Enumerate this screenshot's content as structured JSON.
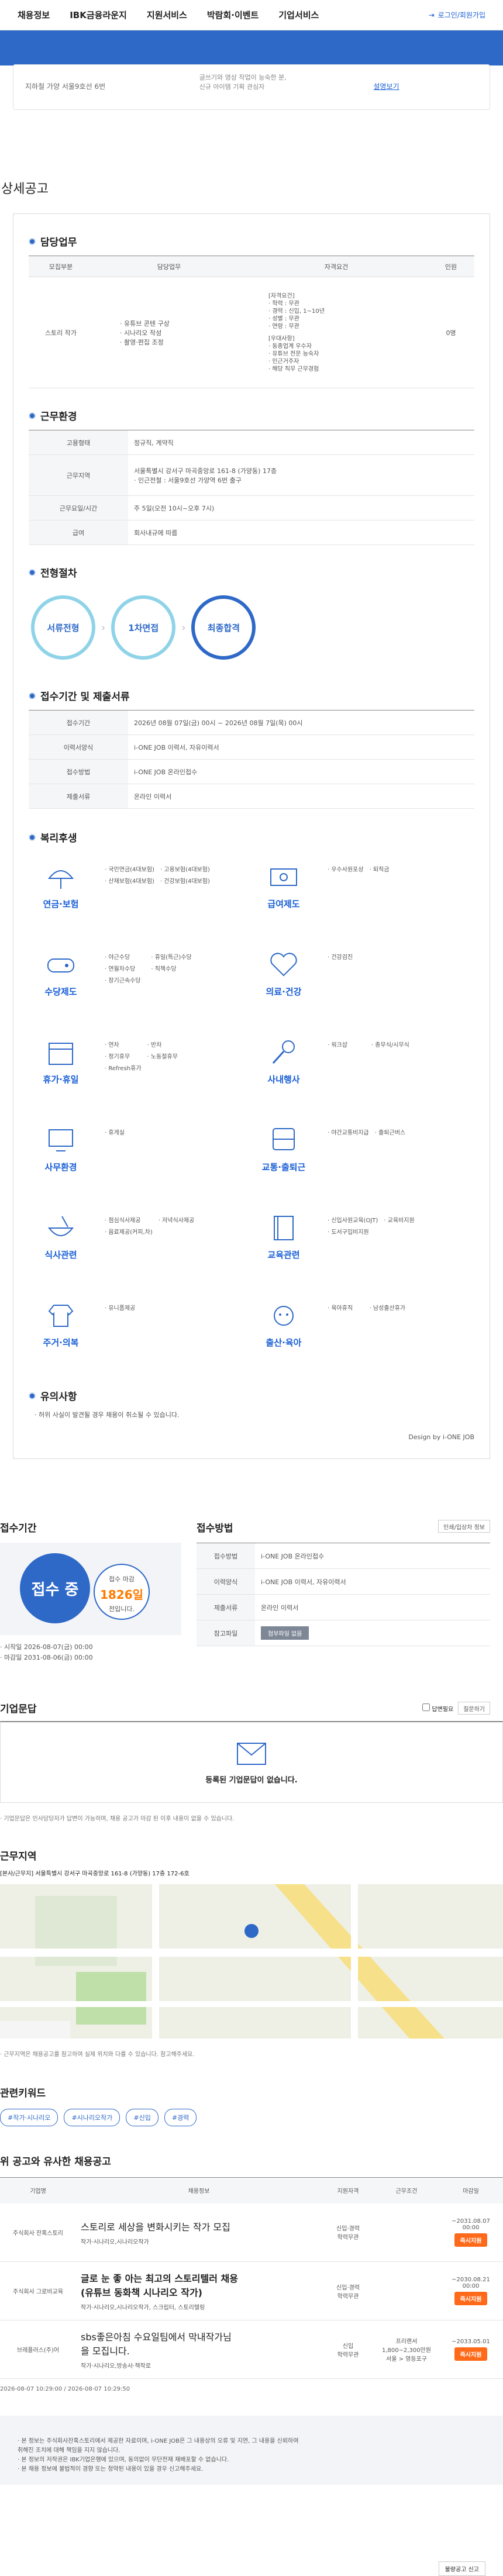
{
  "nav": {
    "items": [
      "채용정보",
      "IBK금융라운지",
      "지원서비스",
      "박람회·이벤트",
      "기업서비스"
    ],
    "login": "로그인/회원가입"
  },
  "hero": {
    "left": "지하철 가양 서울9호선 6번",
    "middle1": "글쓰기와 영상 작업이 능숙한 분,",
    "middle2": "신규 아이템 기획 관심자",
    "right": "설명보기"
  },
  "section_title": "상세공고",
  "duty": {
    "title": "담당업무",
    "headers": [
      "모집부분",
      "담당업무",
      "자격요건",
      "인원"
    ],
    "part": "스토리 작가",
    "tasks": [
      "· 유튜브 콘텐 구상",
      "· 시나리오 작성",
      "· 촬영·편집 조정"
    ],
    "req": [
      "[자격요건]",
      "· 학력 : 무관",
      "· 경력 : 신입, 1~10년",
      "· 성별 : 무관",
      "· 연령 : 무관",
      "",
      "[우대사항]",
      "· 동종업계 우수자",
      "· 유튜브 전문 능숙자",
      "· 인근거주자",
      "· 해당 직무 근무경험"
    ],
    "count": "0명"
  },
  "env": {
    "title": "근무환경",
    "rows": [
      [
        "고용형태",
        "정규직, 계약직"
      ],
      [
        "근무지역",
        "서울특별시 강서구 마곡중앙로 161-8 (가양동) 17층\n· 인근전철 : 서울9호선 가양역 6번 출구"
      ],
      [
        "근무요일/시간",
        "주 5일(오전 10시~오후 7시)"
      ],
      [
        "급여",
        "회사내규에 따름"
      ]
    ]
  },
  "process": {
    "title": "전형절차",
    "steps": [
      "서류전형",
      "1차면접",
      "최종합격"
    ]
  },
  "receipt": {
    "title": "접수기간 및 제출서류",
    "rows": [
      [
        "접수기간",
        "2026년 08월 07일(금) 00시 ~ 2026년 08월 7일(목) 00시"
      ],
      [
        "이력서양식",
        "i-ONE JOB 이력서, 자유이력서"
      ],
      [
        "접수방법",
        "i-ONE JOB 온라인접수"
      ],
      [
        "제출서류",
        "온라인 이력서"
      ]
    ]
  },
  "benefits": {
    "title": "복리후생",
    "items": [
      {
        "name": "연금·보험",
        "icon": "umbrella-icon",
        "list": [
          "· 국민연금(4대보험)",
          "· 고용보험(4대보험)",
          "· 산재보험(4대보험)",
          "· 건강보험(4대보험)"
        ]
      },
      {
        "name": "급여제도",
        "icon": "money-icon",
        "list": [
          "· 우수사원포상",
          "· 퇴직금"
        ]
      },
      {
        "name": "수당제도",
        "icon": "gamepad-icon",
        "list": [
          "· 야근수당",
          "· 휴일(특근)수당",
          "· 연월차수당",
          "· 직책수당",
          "· 장기근속수당"
        ]
      },
      {
        "name": "의료·건강",
        "icon": "heart-icon",
        "list": [
          "· 건강검진"
        ]
      },
      {
        "name": "휴가·휴일",
        "icon": "calendar-icon",
        "list": [
          "· 연차",
          "· 반차",
          "· 정기휴무",
          "· 노동절휴무",
          "· Refresh휴가"
        ]
      },
      {
        "name": "사내행사",
        "icon": "microphone-icon",
        "list": [
          "· 워크샵",
          "· 종무식/시무식"
        ]
      },
      {
        "name": "사무환경",
        "icon": "monitor-icon",
        "list": [
          "· 휴게실"
        ]
      },
      {
        "name": "교통·출퇴근",
        "icon": "bus-icon",
        "list": [
          "· 야간교통비지급",
          "· 출퇴근버스"
        ]
      },
      {
        "name": "식사관련",
        "icon": "bowl-icon",
        "list": [
          "· 점심식사제공",
          "· 저녁식사제공",
          "· 음료제공(커피,차)"
        ]
      },
      {
        "name": "교육관련",
        "icon": "book-icon",
        "list": [
          "· 신입사원교육(OJT)",
          "· 교육비지원",
          "· 도서구입비지원"
        ]
      },
      {
        "name": "주거·의복",
        "icon": "shirt-icon",
        "list": [
          "· 유니폼제공"
        ]
      },
      {
        "name": "출산·육아",
        "icon": "baby-icon",
        "list": [
          "· 육아휴직",
          "· 남성출산휴가"
        ]
      }
    ]
  },
  "caution": {
    "title": "유의사항",
    "text": "· 허위 사실이 발견될 경우 채용이 취소될 수 있습니다."
  },
  "design_by": "Design by i-ONE JOB",
  "apply": {
    "period_title": "접수기간",
    "status": "접수 중",
    "remain_label": "접수 마감",
    "remain_days": "1826일",
    "remain_suffix": "전입니다.",
    "start": "· 시작일 2026-08-07(금) 00:00",
    "end": "· 마감일 2031-08-06(금) 00:00",
    "method_title": "접수방법",
    "print_btn": "인쇄/입상차 정보",
    "rows": [
      [
        "접수방법",
        "i-ONE JOB 온라인접수"
      ],
      [
        "이력양식",
        "i-ONE JOB 이력서, 자유이력서"
      ],
      [
        "제출서류",
        "온라인 이력서"
      ],
      [
        "참고파일",
        "첨부파일 없음"
      ]
    ]
  },
  "qna": {
    "title": "기업문답",
    "check": "답변필요",
    "sort": "질문하기",
    "empty": "등록된 기업문답이 없습니다.",
    "note": "· 기업문답은 인사담당자가 답변이 가능하며, 채용 공고가 마감 된 이후 내용이 없을 수 있습니다."
  },
  "location": {
    "title": "근무지역",
    "addr": "[본사/근무지] 서울특별시 강서구 마곡중앙로 161-8 (가양동) 17층 172-6호",
    "note": "· 근무지역은 채용공고를 참고하여 실제 위치와 다를 수 있습니다. 참고해주세요."
  },
  "keywords": {
    "title": "관련키워드",
    "items": [
      "#작가·시나리오",
      "#시나리오작가",
      "#신입",
      "#경력"
    ]
  },
  "similar": {
    "title": "위 공고와 유사한 채용공고",
    "headers": [
      "기업명",
      "채용정보",
      "지원자격",
      "근무조건",
      "마감일"
    ],
    "rows": [
      {
        "company": "주식회사 잔혹스토리",
        "title": "스토리로 세상을 변화시키는 작가 모집",
        "sub": "작가·시나리오,시나리오작가",
        "qual": "신입·경력\n학력무관",
        "cond": "",
        "deadline": "~2031.08.07 00:00",
        "btn": "즉시지원"
      },
      {
        "company": "주식회사 그로비교육",
        "title": "글로 눈 좋 아는 최고의 스토리텔러 채용\n(유튜브 동화책 시나리오 작가)",
        "sub": "작가·시나리오,시나리오작가, 스크립터, 스토리텔링",
        "qual": "신입·경력\n학력무관",
        "cond": "",
        "deadline": "~2030.08.21 00:00",
        "btn": "즉시지원"
      },
      {
        "company": "브레플러스(주)어",
        "title": "sbs좋은아침 수요일팀에서 막내작가님\n을 모집니다.",
        "sub": "작가·시나리오,방송사·책작로",
        "qual": "신입\n학력무관",
        "cond": "프리랜서\n1,800~2,300만원\n서울 > 영등포구",
        "deadline": "~2033.05.01",
        "btn": "즉시지원"
      }
    ],
    "footnote": "2026-08-07 10:29:00 / 2026-08-07 10:29:50"
  },
  "bottom": {
    "lines": [
      "· 본 정보는 주식회사잔혹스토리에서 제공한 자료이며, i-ONE JOB은 그 내용상의 오류 및 지연, 그 내용을 신뢰하여",
      "취해진 조치에 대해 책임을 지지 않습니다.",
      "· 본 정보의 저작권은 IBK기업은행에 있으며, 동의없이 무단전재 재배포할 수 없습니다.",
      "· 본 채용 정보에 불법적이 경향 또는 청약된 내용이 있을 경우 신고해주세요."
    ],
    "report": "불량공고 신고"
  }
}
